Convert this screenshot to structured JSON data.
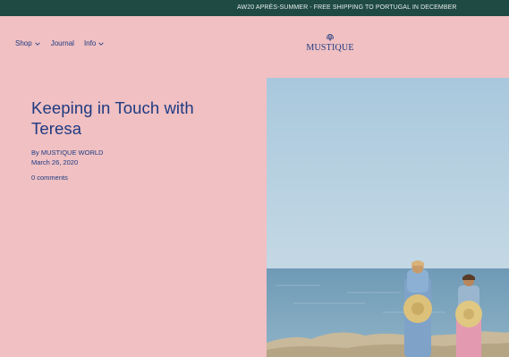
{
  "announcement": {
    "text": "AW20 APRÈS-SUMMER - FREE SHIPPING TO PORTUGAL IN DECEMBER"
  },
  "nav": {
    "items": [
      {
        "label": "Shop",
        "has_dropdown": true
      },
      {
        "label": "Journal",
        "has_dropdown": false
      },
      {
        "label": "Info",
        "has_dropdown": true
      }
    ]
  },
  "brand": {
    "name": "MUSTIQUE"
  },
  "article": {
    "title": "Keeping in Touch with Teresa",
    "byline_prefix": "By",
    "author": "MUSTIQUE WORLD",
    "date": "March 26, 2020",
    "comments": "0 comments"
  },
  "colors": {
    "background": "#f0c0c2",
    "announcement_bar": "#1f4a44",
    "text": "#1e3a82"
  },
  "hero_image": {
    "subject": "two people with straw hats facing the sea on rocks"
  }
}
